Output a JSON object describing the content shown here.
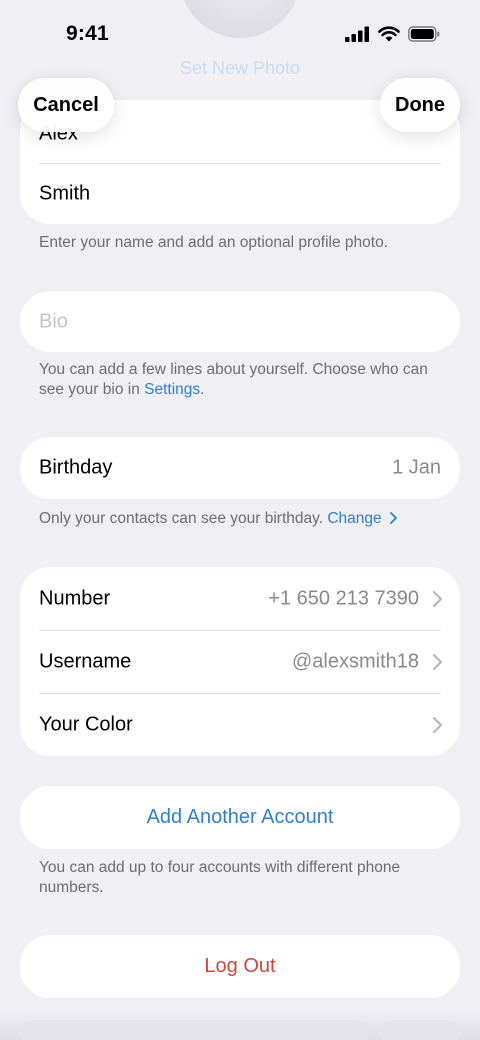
{
  "status_bar": {
    "time": "9:41"
  },
  "header": {
    "set_photo_label": "Set New Photo",
    "cancel_label": "Cancel",
    "done_label": "Done"
  },
  "name_card": {
    "first_name": "Alex",
    "last_name": "Smith",
    "footnote": "Enter your name and add an optional profile photo."
  },
  "bio": {
    "placeholder": "Bio",
    "footnote_before": "You can add a few lines about yourself. Choose who can see your bio in ",
    "footnote_link": "Settings",
    "footnote_after": "."
  },
  "birthday": {
    "label": "Birthday",
    "value": "1 Jan",
    "footnote": "Only your contacts can see your birthday.",
    "change_link": "Change"
  },
  "account_rows": [
    {
      "label": "Number",
      "value": "+1 650 213 7390"
    },
    {
      "label": "Username",
      "value": "@alexsmith18"
    },
    {
      "label": "Your Color",
      "value": ""
    }
  ],
  "add_account": {
    "label": "Add Another Account",
    "footnote": "You can add up to four accounts with different phone numbers."
  },
  "logout": {
    "label": "Log Out"
  },
  "colors": {
    "accent": "#2f80d1",
    "destructive": "#d0473c",
    "background": "#efeff4",
    "secondary_text": "#8a8a8e"
  }
}
